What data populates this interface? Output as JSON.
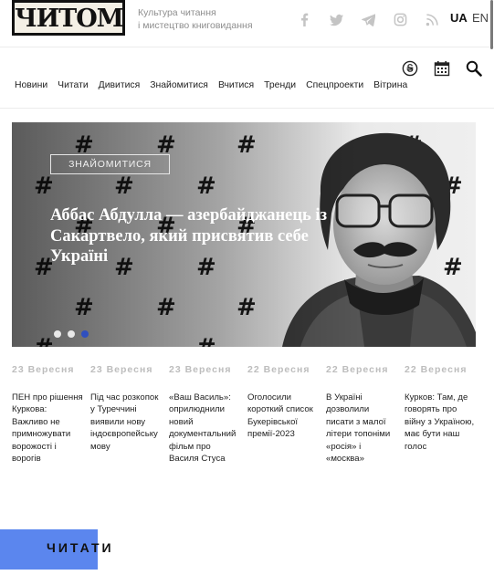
{
  "site": {
    "logo_text": "ЧИТОМО",
    "tagline_line1": "Культура читання",
    "tagline_line2": "і мистецтво книговидання"
  },
  "socials": [
    {
      "name": "facebook-icon"
    },
    {
      "name": "twitter-icon"
    },
    {
      "name": "telegram-icon"
    },
    {
      "name": "instagram-icon"
    },
    {
      "name": "rss-icon"
    }
  ],
  "languages": {
    "active": "UA",
    "other": "EN"
  },
  "tools": [
    "currency-icon",
    "calendar-icon",
    "search-icon"
  ],
  "nav": {
    "items": [
      "Новини",
      "Читати",
      "Дивитися",
      "Знайомитися",
      "Вчитися",
      "Тренди",
      "Спецпроекти",
      "Вітрина"
    ]
  },
  "hero": {
    "category": "ЗНАЙОМИТИСЯ",
    "title": "Аббас Абдулла — азербайджанець із Сакартвело, який присвятив себе Україні",
    "slides_total": 3,
    "active_slide": 3
  },
  "news": [
    {
      "date": "23 Вересня",
      "title": "ПЕН про рішення Куркова: Важливо не примножувати ворожості і ворогів"
    },
    {
      "date": "23 Вересня",
      "title": "Під час розкопок у Туреччині виявили нову індоєвропейську мову"
    },
    {
      "date": "23 Вересня",
      "title": "«Ваш Василь»: оприлюднили новий документальний фільм про Василя Стуса"
    },
    {
      "date": "22 Вересня",
      "title": "Оголосили короткий список Букерівської премії-2023"
    },
    {
      "date": "22 Вересня",
      "title": "В Україні дозволили писати з малої літери топоніми «росія» і «москва»"
    },
    {
      "date": "22 Вересня",
      "title": "Курков: Там, де говорять про війну з Україною, має бути наш голос"
    }
  ],
  "section": {
    "read_label": "ЧИТАТИ"
  },
  "colors": {
    "accent_blue": "#5b86ee",
    "active_dot": "#2f4fbf"
  }
}
